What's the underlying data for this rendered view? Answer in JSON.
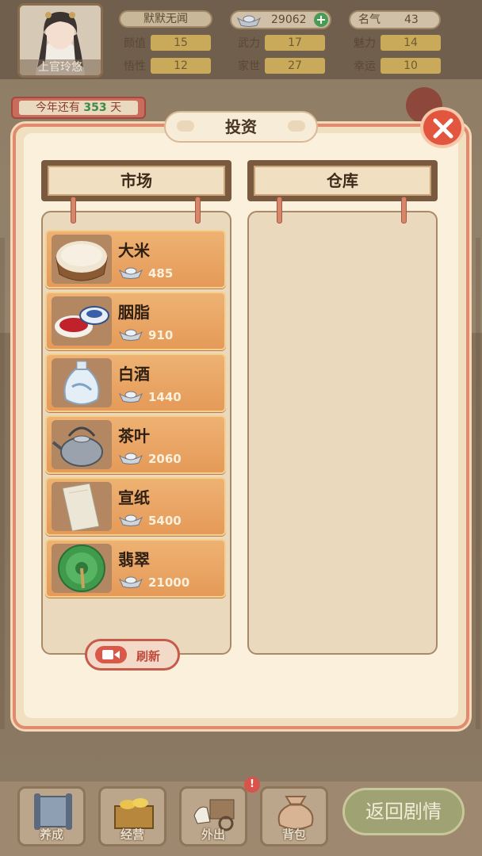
{
  "player": {
    "name": "上官玲悠",
    "title": "默默无闻",
    "silver": "29062",
    "fame_label": "名气",
    "fame_value": "43"
  },
  "stats": [
    {
      "label": "颜值",
      "value": "15"
    },
    {
      "label": "武力",
      "value": "17"
    },
    {
      "label": "魅力",
      "value": "14"
    },
    {
      "label": "悟性",
      "value": "12"
    },
    {
      "label": "家世",
      "value": "27"
    },
    {
      "label": "幸运",
      "value": "10"
    }
  ],
  "days": {
    "prefix": "今年还有",
    "count": "353",
    "suffix": "天"
  },
  "modal": {
    "title": "投资",
    "market_label": "市场",
    "warehouse_label": "仓库",
    "refresh_label": "刷新"
  },
  "market_items": [
    {
      "name": "大米",
      "price": "485",
      "icon": "rice-basket-icon"
    },
    {
      "name": "胭脂",
      "price": "910",
      "icon": "rouge-box-icon"
    },
    {
      "name": "白酒",
      "price": "1440",
      "icon": "liquor-bottle-icon"
    },
    {
      "name": "茶叶",
      "price": "2060",
      "icon": "teapot-icon"
    },
    {
      "name": "宣纸",
      "price": "5400",
      "icon": "paper-scroll-icon"
    },
    {
      "name": "翡翠",
      "price": "21000",
      "icon": "jade-disc-icon"
    }
  ],
  "nav": {
    "items": [
      {
        "label": "养成",
        "icon": "scroll-icon"
      },
      {
        "label": "经营",
        "icon": "gold-ingot-box-icon"
      },
      {
        "label": "外出",
        "icon": "horse-carriage-icon"
      },
      {
        "label": "背包",
        "icon": "cloth-bag-icon"
      }
    ],
    "badge": "!",
    "return_label": "返回剧情"
  }
}
